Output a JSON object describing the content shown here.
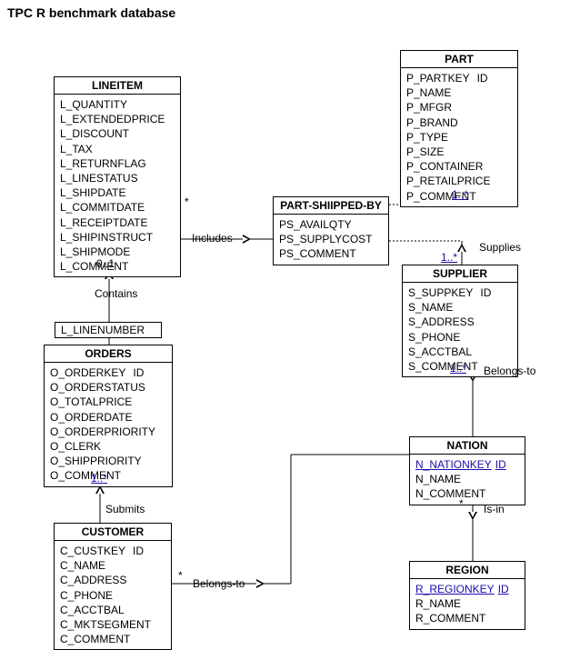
{
  "title": "TPC R benchmark database",
  "entities": {
    "lineitem": {
      "name": "LINEITEM",
      "attrs": [
        {
          "name": "L_QUANTITY"
        },
        {
          "name": "L_EXTENDEDPRICE"
        },
        {
          "name": "L_DISCOUNT"
        },
        {
          "name": "L_TAX"
        },
        {
          "name": "L_RETURNFLAG"
        },
        {
          "name": "L_LINESTATUS"
        },
        {
          "name": "L_SHIPDATE"
        },
        {
          "name": "L_COMMITDATE"
        },
        {
          "name": "L_RECEIPTDATE"
        },
        {
          "name": "L_SHIPINSTRUCT"
        },
        {
          "name": "L_SHIPMODE"
        },
        {
          "name": "L_COMMENT"
        }
      ]
    },
    "part": {
      "name": "PART",
      "attrs": [
        {
          "name": "P_PARTKEY",
          "id": "ID"
        },
        {
          "name": "P_NAME"
        },
        {
          "name": "P_MFGR"
        },
        {
          "name": "P_BRAND"
        },
        {
          "name": "P_TYPE"
        },
        {
          "name": "P_SIZE"
        },
        {
          "name": "P_CONTAINER"
        },
        {
          "name": "P_RETAILPRICE"
        },
        {
          "name": "P_COMMENT"
        }
      ]
    },
    "partshippedby": {
      "name": "PART-SHIIPPED-BY",
      "attrs": [
        {
          "name": "PS_AVAILQTY"
        },
        {
          "name": "PS_SUPPLYCOST"
        },
        {
          "name": "PS_COMMENT"
        }
      ]
    },
    "supplier": {
      "name": "SUPPLIER",
      "attrs": [
        {
          "name": "S_SUPPKEY",
          "id": "ID"
        },
        {
          "name": "S_NAME"
        },
        {
          "name": "S_ADDRESS"
        },
        {
          "name": "S_PHONE"
        },
        {
          "name": "S_ACCTBAL"
        },
        {
          "name": "S_COMMENT"
        }
      ]
    },
    "nation": {
      "name": "NATION",
      "attrs": [
        {
          "name": "N_NATIONKEY",
          "id": "ID",
          "underline": true,
          "_": "Text"
        },
        {
          "name": "N_NAME"
        },
        {
          "name": "N_COMMENT"
        }
      ]
    },
    "region": {
      "name": "REGION",
      "attrs": [
        {
          "name": "R_REGIONKEY",
          "id": "ID",
          "underline": true
        },
        {
          "name": "R_NAME"
        },
        {
          "name": "R_COMMENT"
        }
      ]
    },
    "orders": {
      "name": "ORDERS",
      "attrs": [
        {
          "name": "O_ORDERKEY",
          "id": "ID"
        },
        {
          "name": "O_ORDERSTATUS"
        },
        {
          "name": "O_TOTALPRICE"
        },
        {
          "name": "O_ORDERDATE"
        },
        {
          "name": "O_ORDERPRIORITY"
        },
        {
          "name": "O_CLERK"
        },
        {
          "name": "O_SHIPPRIORITY"
        },
        {
          "name": "O_COMMENT"
        }
      ]
    },
    "linenum": {
      "name": "L_LINENUMBER"
    },
    "customer": {
      "name": "CUSTOMER",
      "attrs": [
        {
          "name": "C_CUSTKEY",
          "id": "ID"
        },
        {
          "name": "C_NAME"
        },
        {
          "name": "C_ADDRESS"
        },
        {
          "name": "C_PHONE"
        },
        {
          "name": "C_ACCTBAL"
        },
        {
          "name": "C_MKTSEGMENT"
        },
        {
          "name": "C_COMMENT"
        }
      ]
    }
  },
  "relations": {
    "includes": "Includes",
    "contains": "Contains",
    "supplies": "Supplies",
    "belongs_to_1": "Belongs-to",
    "belongs_to_2": "Belongs-to",
    "is_in": "Is-in",
    "submits": "Submits"
  },
  "mult": {
    "m_star_li": "*",
    "m_01_li": "0..1",
    "m_1s_part": "1..*",
    "m_1s_supp": "1..*",
    "m_1s_supp2": "1..*",
    "m_1s_orders": "1..*",
    "m_star_cust": "*",
    "m_star_nat": "*"
  }
}
